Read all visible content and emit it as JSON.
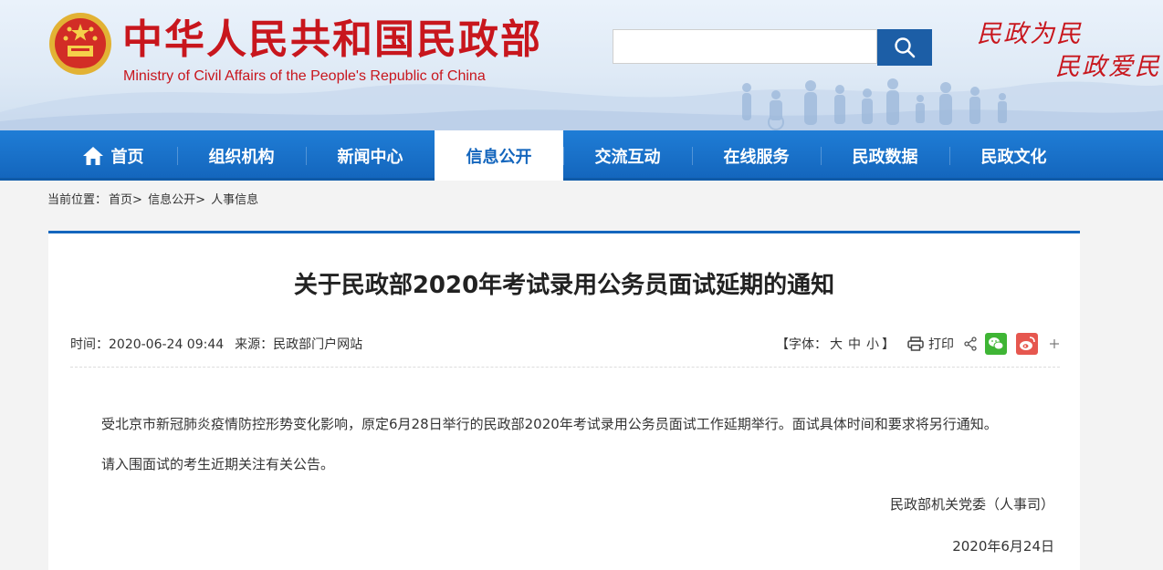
{
  "header": {
    "title_cn": "中华人民共和国民政部",
    "title_en": "Ministry of Civil Affairs of the People's Republic of China",
    "search": {
      "value": "",
      "placeholder": ""
    },
    "search_button_icon": "search-icon",
    "slogan_line1": "民政为民",
    "slogan_line2": "民政爱民"
  },
  "nav": {
    "items": [
      {
        "label": "首页",
        "icon": "home-icon"
      },
      {
        "label": "组织机构"
      },
      {
        "label": "新闻中心"
      },
      {
        "label": "信息公开",
        "active": true
      },
      {
        "label": "交流互动"
      },
      {
        "label": "在线服务"
      },
      {
        "label": "民政数据"
      },
      {
        "label": "民政文化"
      }
    ]
  },
  "breadcrumb": {
    "prefix": "当前位置：",
    "items": [
      "首页>",
      "信息公开>",
      "人事信息"
    ]
  },
  "article": {
    "title": "关于民政部2020年考试录用公务员面试延期的通知",
    "time_label": "时间：",
    "time": "2020-06-24 09:44",
    "source_label": "来源：",
    "source": "民政部门户网站",
    "font_size": {
      "open": "【字体：",
      "large": "大",
      "medium": "中",
      "small": "小",
      "close": "】"
    },
    "print_label": "打印",
    "paragraphs": [
      "受北京市新冠肺炎疫情防控形势变化影响，原定6月28日举行的民政部2020年考试录用公务员面试工作延期举行。面试具体时间和要求将另行通知。",
      "请入围面试的考生近期关注有关公告。"
    ],
    "signature": "民政部机关党委（人事司）",
    "date": "2020年6月24日"
  },
  "colors": {
    "brand_red": "#c8161d",
    "nav_blue": "#1466bd",
    "wechat_green": "#3fb535",
    "weibo_red": "#e6574f"
  }
}
